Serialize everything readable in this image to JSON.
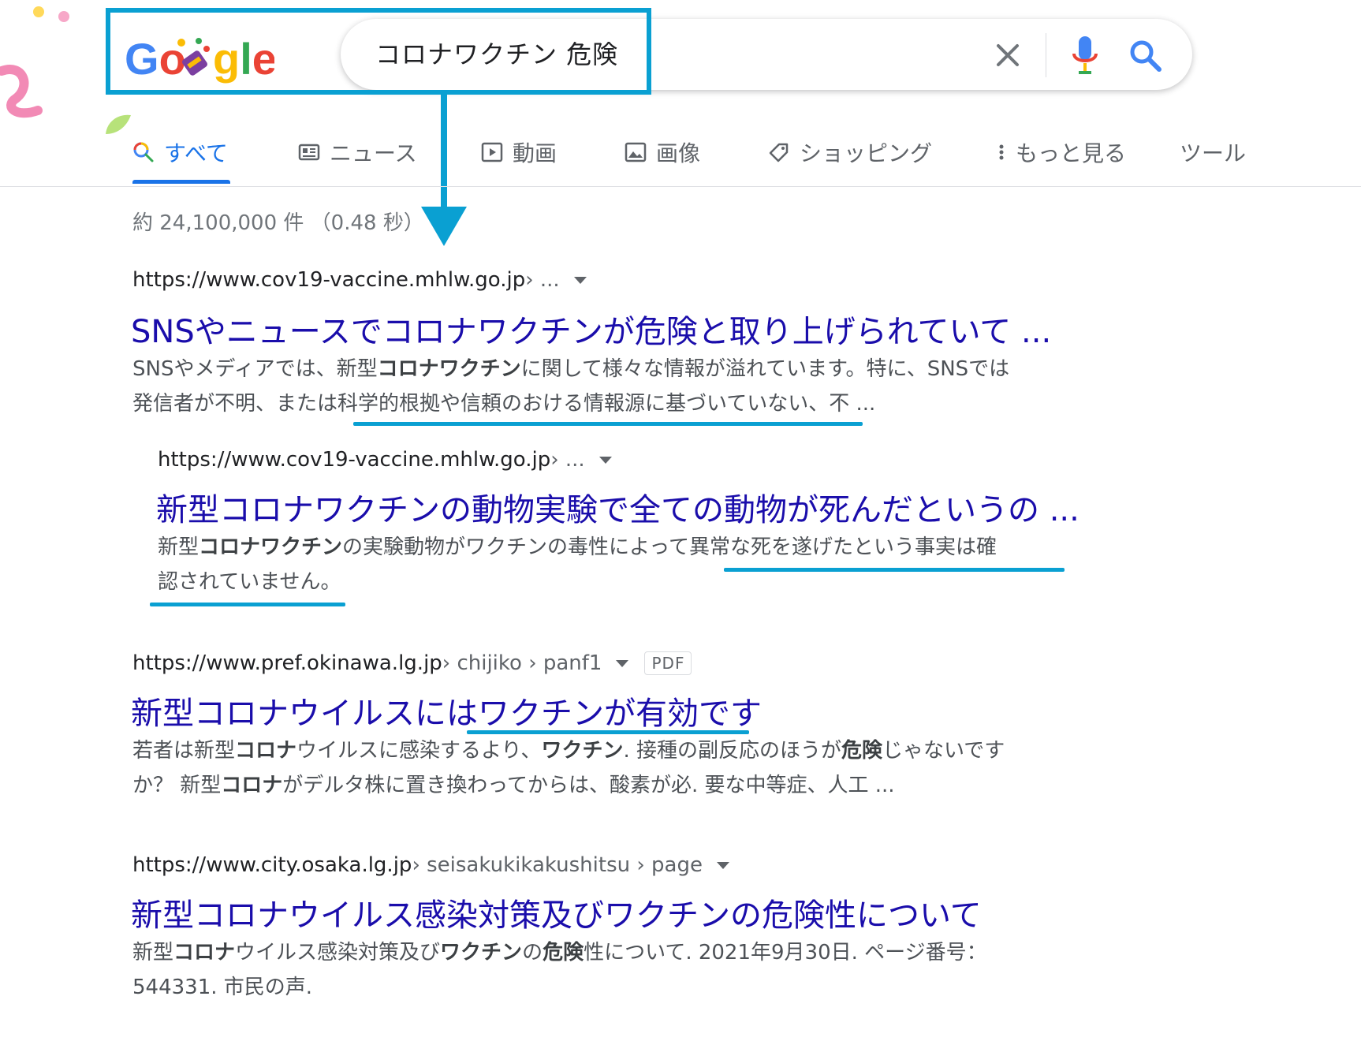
{
  "search": {
    "query": "コロナワクチン 危険",
    "logo_text": "Google"
  },
  "tabs": [
    {
      "label": "すべて",
      "icon": "search-icon"
    },
    {
      "label": "ニュース",
      "icon": "news-icon"
    },
    {
      "label": "動画",
      "icon": "video-icon"
    },
    {
      "label": "画像",
      "icon": "image-icon"
    },
    {
      "label": "ショッピング",
      "icon": "tag-icon"
    },
    {
      "label": "もっと見る",
      "icon": "more-vert-icon"
    },
    {
      "label": "ツール",
      "icon": ""
    }
  ],
  "stats": "約 24,100,000 件 （0.48 秒）",
  "results": [
    {
      "url_host": "https://www.cov19-vaccine.mhlw.go.jp",
      "url_crumbs": " › ...",
      "title": "SNSやニュースでコロナワクチンが危険と取り上げられていて ...",
      "snippet_line1": [
        {
          "t": "SNSやメディアでは、新型",
          "b": false
        },
        {
          "t": "コロナワクチン",
          "b": true
        },
        {
          "t": "に関して様々な情報が溢れています。特に、SNSでは",
          "b": false
        }
      ],
      "snippet_line2": [
        {
          "t": "発信者が不明、または科学的根拠や信頼のおける情報源に基づいていない、不 ...",
          "b": false
        }
      ]
    },
    {
      "url_host": "https://www.cov19-vaccine.mhlw.go.jp",
      "url_crumbs": " › ...",
      "title": "新型コロナワクチンの動物実験で全ての動物が死んだというの ...",
      "snippet_line1": [
        {
          "t": "新型",
          "b": false
        },
        {
          "t": "コロナワクチン",
          "b": true
        },
        {
          "t": "の実験動物がワクチンの毒性によって異常な死を遂げたという事実は確",
          "b": false
        }
      ],
      "snippet_line2": [
        {
          "t": "認されていません。",
          "b": false
        }
      ]
    },
    {
      "url_host": "https://www.pref.okinawa.lg.jp",
      "url_crumbs": " › chijiko › panf1",
      "badge": "PDF",
      "title": "新型コロナウイルスにはワクチンが有効です",
      "snippet_line1": [
        {
          "t": "若者は新型",
          "b": false
        },
        {
          "t": "コロナ",
          "b": true
        },
        {
          "t": "ウイルスに感染するより、",
          "b": false
        },
        {
          "t": "ワクチン",
          "b": true
        },
        {
          "t": ". 接種の副反応のほうが",
          "b": false
        },
        {
          "t": "危険",
          "b": true
        },
        {
          "t": "じゃないです",
          "b": false
        }
      ],
      "snippet_line2": [
        {
          "t": "か？ 新型",
          "b": false
        },
        {
          "t": "コロナ",
          "b": true
        },
        {
          "t": "がデルタ株に置き換わってからは、酸素が必. 要な中等症、人工 ...",
          "b": false
        }
      ]
    },
    {
      "url_host": "https://www.city.osaka.lg.jp",
      "url_crumbs": " › seisakukikakushitsu › page",
      "title": "新型コロナウイルス感染対策及びワクチンの危険性について",
      "snippet_line1": [
        {
          "t": "新型",
          "b": false
        },
        {
          "t": "コロナ",
          "b": true
        },
        {
          "t": "ウイルス感染対策及び",
          "b": false
        },
        {
          "t": "ワクチン",
          "b": true
        },
        {
          "t": "の",
          "b": false
        },
        {
          "t": "危険",
          "b": true
        },
        {
          "t": "性について. 2021年9月30日. ページ番号：",
          "b": false
        }
      ],
      "snippet_line2": [
        {
          "t": "544331. 市民の声.",
          "b": false
        }
      ]
    }
  ],
  "colors": {
    "link": "#1a0dab",
    "accent": "#1a73e8",
    "annotation": "#0aa0d2"
  }
}
